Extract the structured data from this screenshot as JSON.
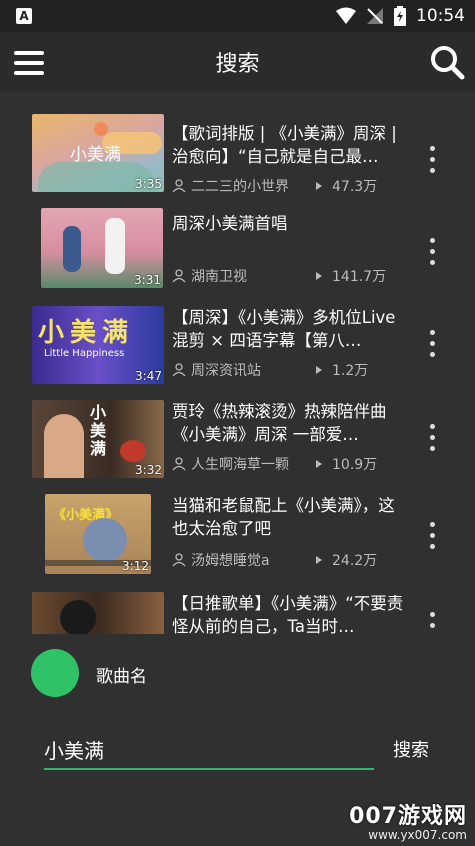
{
  "status_bar": {
    "time": "10:54",
    "left_icon": "A"
  },
  "app_bar": {
    "title": "搜索",
    "menu_icon": "hamburger-icon",
    "search_icon": "search-icon"
  },
  "results": [
    {
      "title": "【歌词排版 | 《小美满》周深 | 治愈向】“自己就是自己最…",
      "uploader": "二二三的小世界",
      "views": "47.3万",
      "duration": "3:35",
      "thumb_text": "小美满"
    },
    {
      "title": "周深小美满首唱",
      "uploader": "湖南卫视",
      "views": "141.7万",
      "duration": "3:31"
    },
    {
      "title": "【周深】《小美满》多机位Live混剪 × 四语字幕【第八…",
      "uploader": "周深资讯站",
      "views": "1.2万",
      "duration": "3:47",
      "thumb_text": "小美满",
      "thumb_sub": "Little Happiness"
    },
    {
      "title": "贾玲《热辣滚烫》热辣陪伴曲 《小美满》周深 一部爱…",
      "uploader": "人生啊海草一颗",
      "views": "10.9万",
      "duration": "3:32",
      "thumb_text": "小美满"
    },
    {
      "title": "当猫和老鼠配上《小美满》，这也太治愈了吧",
      "uploader": "汤姆想睡觉a",
      "views": "24.2万",
      "duration": "3:12",
      "thumb_text": "《小美满》"
    },
    {
      "title": "【日推歌单】《小美满》“不要责怪从前的自己，Ta当时…",
      "uploader": "",
      "views": "",
      "duration": ""
    }
  ],
  "song_row": {
    "label": "歌曲名"
  },
  "search_bar": {
    "value": "小美满",
    "button_label": "搜索"
  },
  "watermark": {
    "main": "007游戏网",
    "url": "www.yx007.com"
  },
  "colors": {
    "accent": "#2fc267",
    "background": "#303030",
    "status_bar": "#222222"
  }
}
